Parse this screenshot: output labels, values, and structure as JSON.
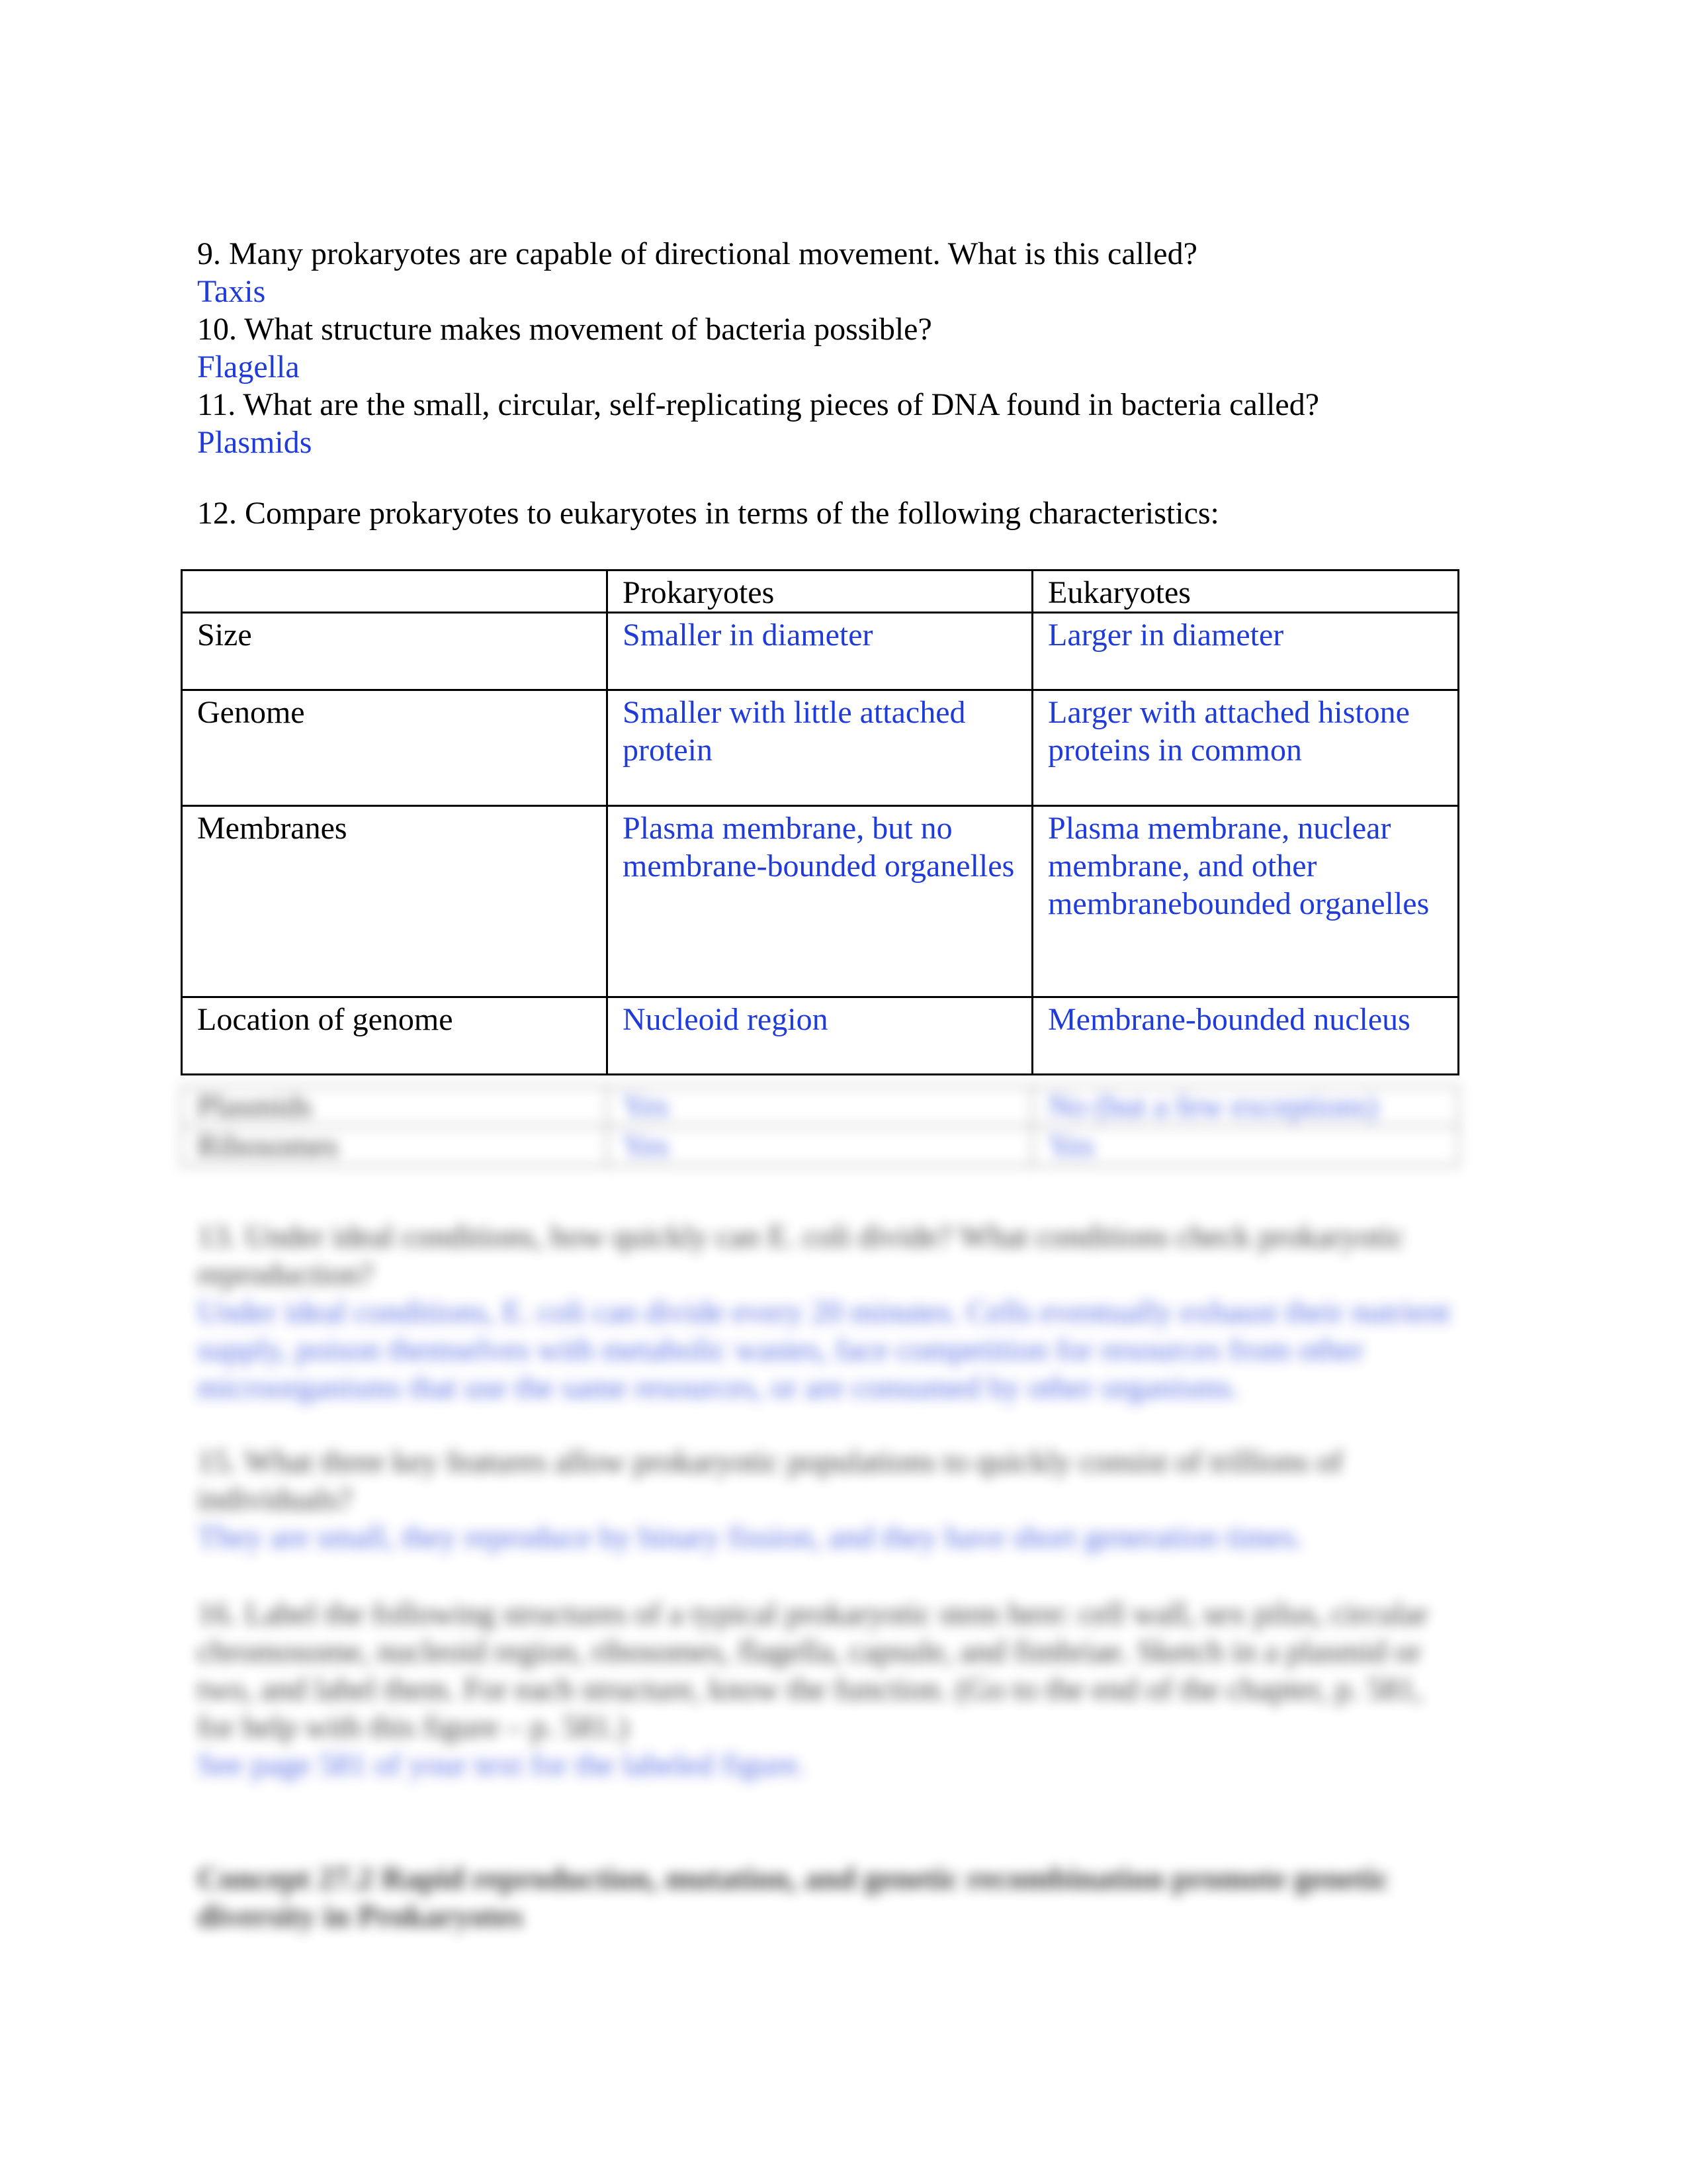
{
  "questions": [
    {
      "number": "9.",
      "text": "Many prokaryotes are capable of directional movement. What is this called?",
      "answer": "Taxis"
    },
    {
      "number": "10.",
      "text": "What structure makes movement of bacteria possible?",
      "answer": "Flagella"
    },
    {
      "number": "11.",
      "text": "What are the small, circular, self-replicating pieces of DNA found in bacteria called?",
      "answer": "Plasmids"
    }
  ],
  "q12": {
    "number": "12.",
    "text": "Compare prokaryotes to eukaryotes in terms of the following characteristics:"
  },
  "table": {
    "headers": [
      "",
      "Prokaryotes",
      "Eukaryotes"
    ],
    "rows": [
      {
        "label": "Size",
        "prokaryotes": "Smaller in diameter",
        "eukaryotes": "Larger in diameter"
      },
      {
        "label": "Genome",
        "prokaryotes": "Smaller with little attached protein",
        "eukaryotes": "Larger with attached histone proteins in common"
      },
      {
        "label": "Membranes",
        "prokaryotes": "Plasma membrane, but no membrane-bounded organelles",
        "eukaryotes": "Plasma membrane, nuclear membrane, and other membranebounded organelles"
      },
      {
        "label": "Location of genome",
        "prokaryotes": "Nucleoid region",
        "eukaryotes": "Membrane-bounded nucleus"
      },
      {
        "label": "Plasmids",
        "prokaryotes": "Yes",
        "eukaryotes": "No (but a few exceptions)"
      },
      {
        "label": "Ribosomes",
        "prokaryotes": "Yes",
        "eukaryotes": "Yes"
      }
    ]
  },
  "blurred": {
    "q13": "13. Under ideal conditions, how quickly can E. coli divide? What conditions check prokaryotic reproduction?",
    "a13": "Under ideal conditions, E. coli can divide every 20 minutes. Cells eventually exhaust their nutrient supply, poison themselves with metabolic wastes, face competition for resources from other microorganisms that use the same resources, or are consumed by other organisms.",
    "q15": "15. What three key features allow prokaryotic populations to quickly consist of trillions of individuals?",
    "a15": "They are small, they reproduce by binary fission, and they have short generation times.",
    "q16": "16. Label the following structures of a typical prokaryotic stem here: cell wall, sex pilus, circular chromosome, nucleoid region, ribosomes, flagella, capsule, and fimbriae. Sketch in a plasmid or two, and label them. For each structure, know the function. (Go to the end of the chapter, p. 581, for help with this figure – p. 581.)",
    "a16": "See page 581 of your text for the labeled figure.",
    "concept": "Concept 27.2 Rapid reproduction, mutation, and genetic recombination promote genetic diversity in Prokaryotes"
  },
  "colors": {
    "answer": "#1f3bd9",
    "text": "#000000"
  }
}
